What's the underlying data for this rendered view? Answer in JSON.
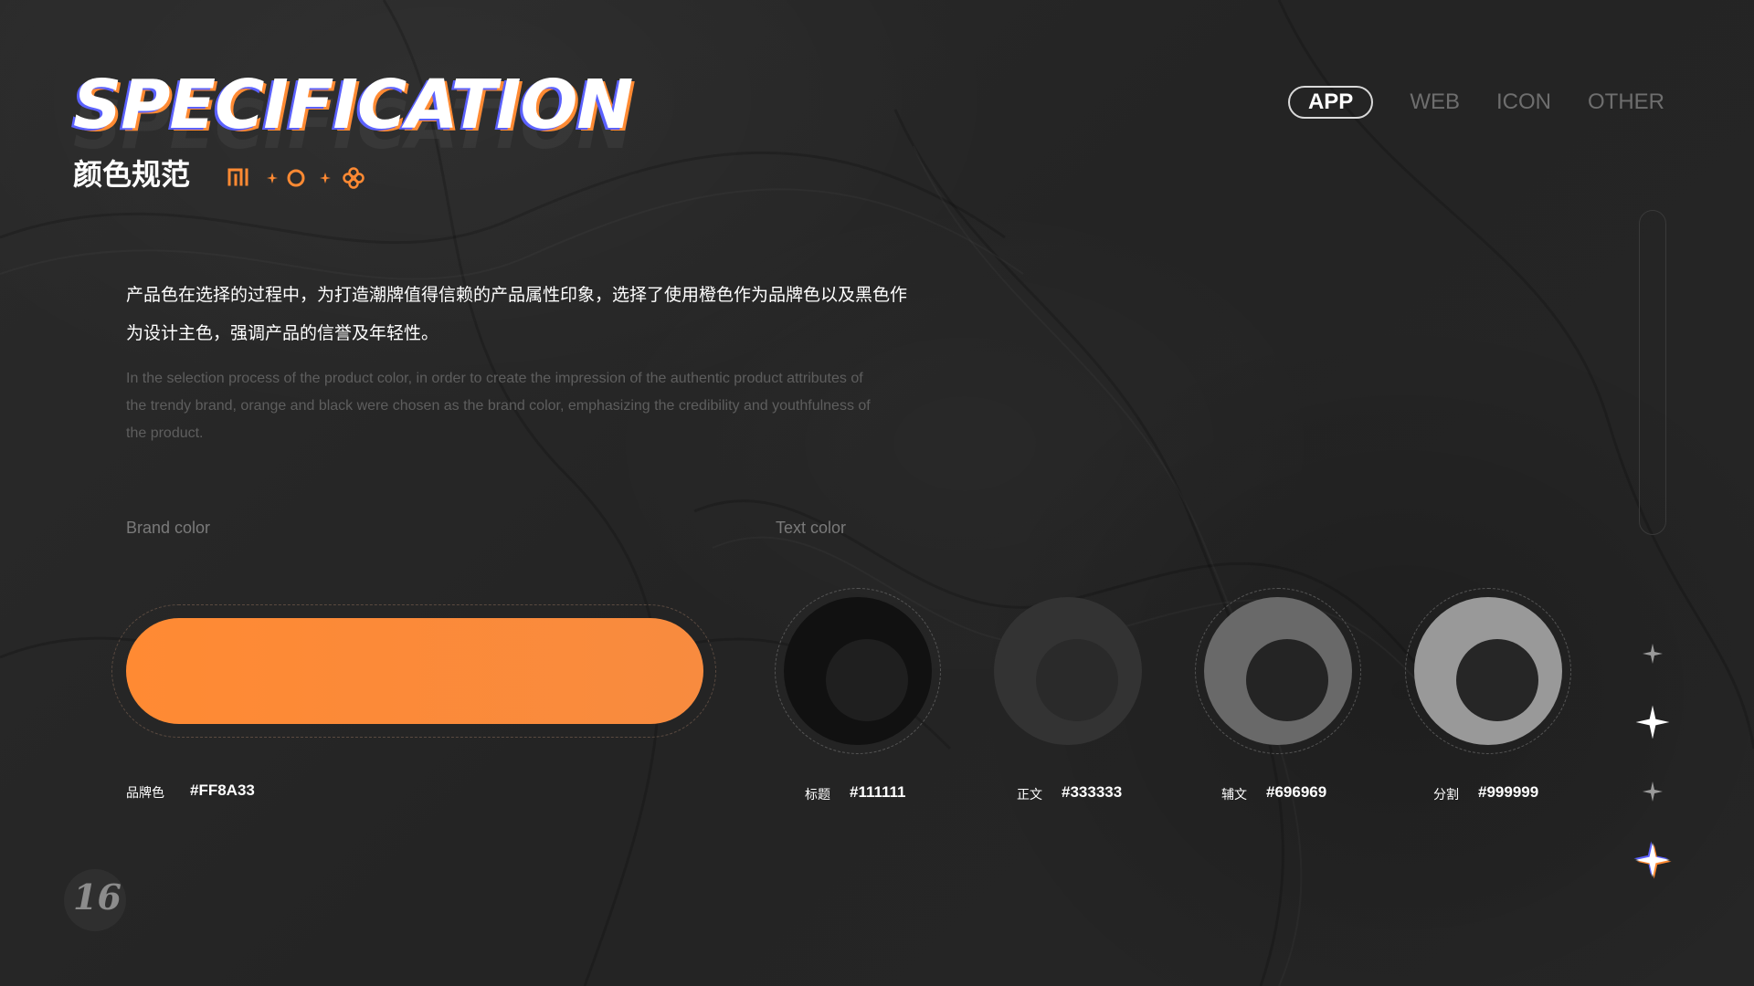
{
  "header": {
    "title": "SPECIFICATION",
    "subtitle": "颜色规范"
  },
  "nav": {
    "items": [
      {
        "label": "APP",
        "active": true
      },
      {
        "label": "WEB",
        "active": false
      },
      {
        "label": "ICON",
        "active": false
      },
      {
        "label": "OTHER",
        "active": false
      }
    ]
  },
  "description": {
    "cn": "产品色在选择的过程中，为打造潮牌值得信赖的产品属性印象，选择了使用橙色作为品牌色以及黑色作为设计主色，强调产品的信誉及年轻性。",
    "en": "In the selection process of the product color, in order to create the impression of the authentic product attributes of the trendy brand, orange and black were chosen as the brand color, emphasizing the credibility and youthfulness of the product."
  },
  "brand": {
    "section_label": "Brand color",
    "swatch_label": "品牌色",
    "hex": "#FF8A33"
  },
  "text_colors": {
    "section_label": "Text color",
    "swatches": [
      {
        "label": "标题",
        "hex": "#111111"
      },
      {
        "label": "正文",
        "hex": "#333333"
      },
      {
        "label": "辅文",
        "hex": "#696969"
      },
      {
        "label": "分割",
        "hex": "#999999"
      }
    ]
  },
  "page": {
    "number": "16"
  },
  "colors": {
    "accent": "#FF8A33",
    "secondary_accent": "#5B61FF",
    "background": "#262626"
  },
  "icons": {
    "deco": [
      "mi-logo-icon",
      "sparkle-icon",
      "circle-icon",
      "sparkle-icon",
      "flower-icon"
    ],
    "rail": [
      "sparkle-icon",
      "sparkle-icon",
      "sparkle-icon",
      "color-sparkle-icon"
    ]
  }
}
